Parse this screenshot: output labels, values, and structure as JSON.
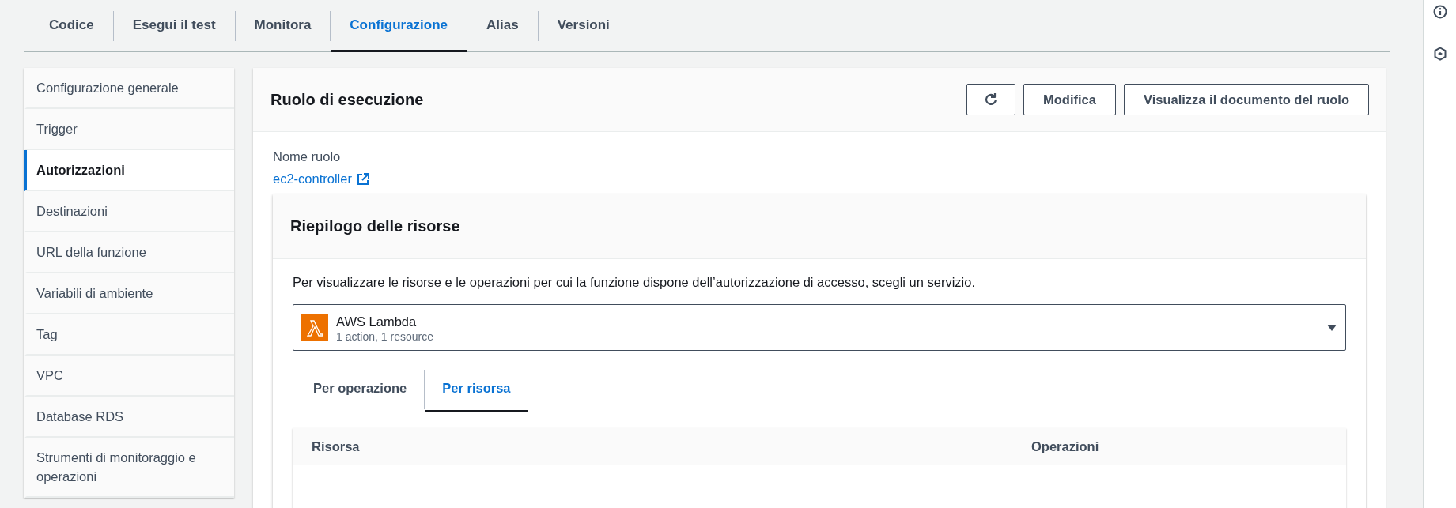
{
  "main_tabs": [
    {
      "label": "Codice",
      "selected": false
    },
    {
      "label": "Esegui il test",
      "selected": false
    },
    {
      "label": "Monitora",
      "selected": false
    },
    {
      "label": "Configurazione",
      "selected": true
    },
    {
      "label": "Alias",
      "selected": false
    },
    {
      "label": "Versioni",
      "selected": false
    }
  ],
  "sidebar": {
    "items": [
      {
        "label": "Configurazione generale",
        "selected": false
      },
      {
        "label": "Trigger",
        "selected": false
      },
      {
        "label": "Autorizzazioni",
        "selected": true
      },
      {
        "label": "Destinazioni",
        "selected": false
      },
      {
        "label": "URL della funzione",
        "selected": false
      },
      {
        "label": "Variabili di ambiente",
        "selected": false
      },
      {
        "label": "Tag",
        "selected": false
      },
      {
        "label": "VPC",
        "selected": false
      },
      {
        "label": "Database RDS",
        "selected": false
      },
      {
        "label": "Strumenti di monitoraggio e operazioni",
        "selected": false
      }
    ]
  },
  "execution_role": {
    "title": "Ruolo di esecuzione",
    "buttons": [
      {
        "kind": "refresh"
      },
      {
        "kind": "text",
        "label": "Modifica"
      },
      {
        "kind": "text",
        "label": "Visualizza il documento del ruolo"
      }
    ],
    "role_name_label": "Nome ruolo",
    "role_name_link": "ec2-controller"
  },
  "resource_summary": {
    "title": "Riepilogo delle risorse",
    "description": "Per visualizzare le risorse e le operazioni per cui la funzione dispone dell’autorizzazione di accesso, scegli un servizio.",
    "service": {
      "name": "AWS Lambda",
      "detail": "1 action, 1 resource"
    },
    "tabs": [
      {
        "label": "Per operazione",
        "selected": false
      },
      {
        "label": "Per risorsa",
        "selected": true
      }
    ],
    "table": {
      "columns": [
        "Risorsa",
        "Operazioni"
      ]
    }
  }
}
